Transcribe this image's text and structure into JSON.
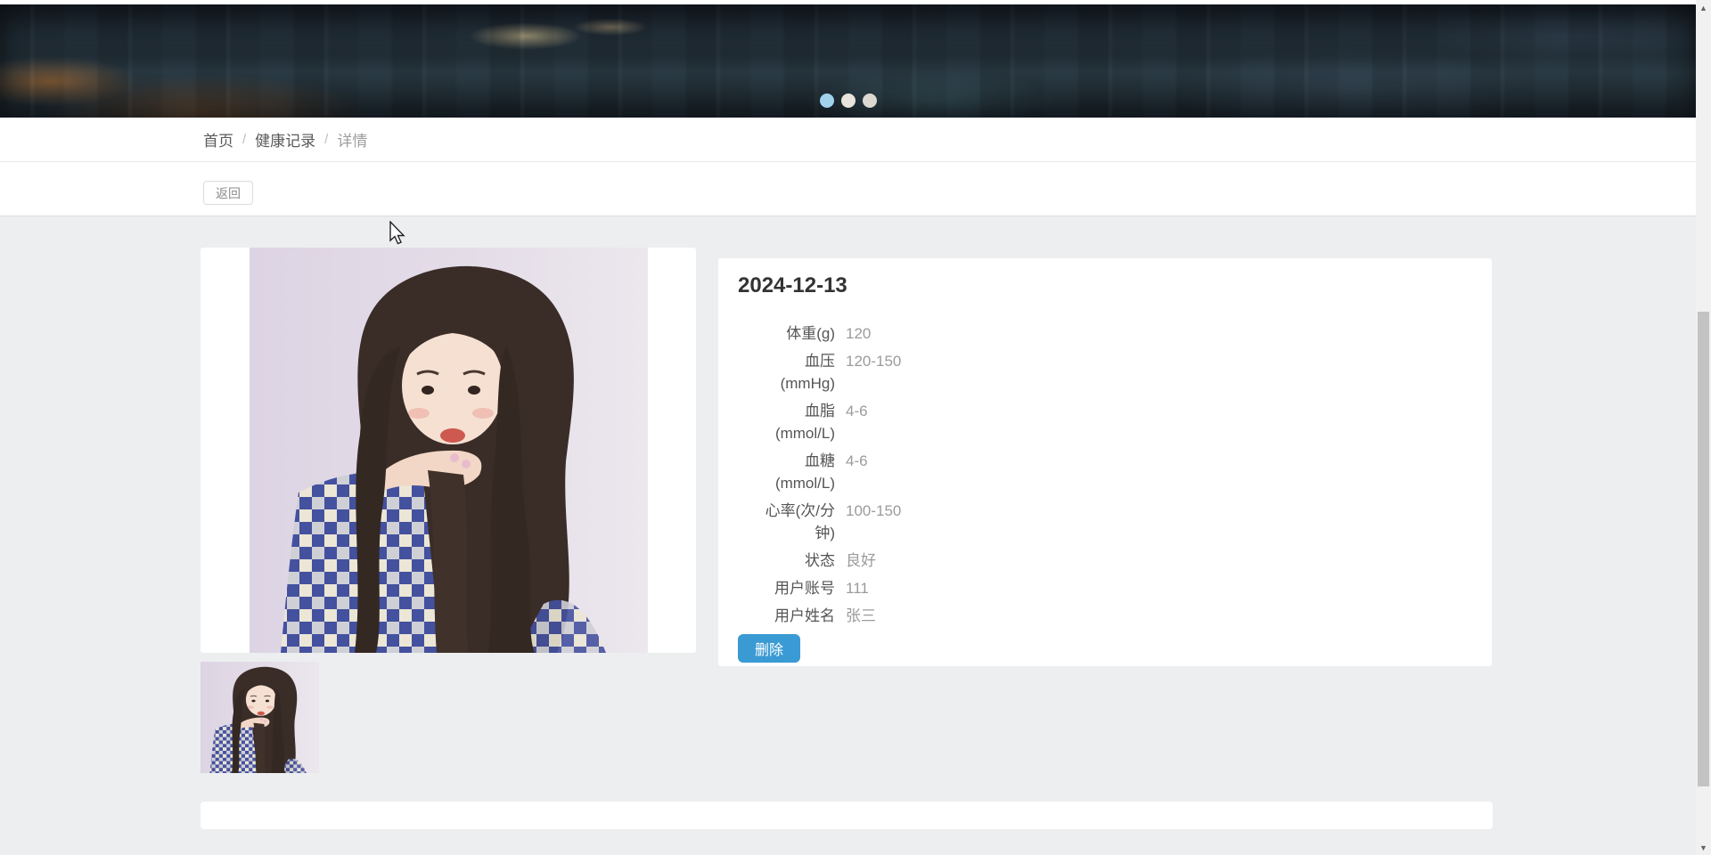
{
  "banner": {
    "description": "city-night-banner-image",
    "slide_count": 3,
    "active_slide": 0
  },
  "breadcrumb": {
    "items": [
      {
        "label": "首页"
      },
      {
        "label": "健康记录"
      },
      {
        "label": "详情"
      }
    ],
    "separator": "/"
  },
  "toolbar": {
    "back_label": "返回"
  },
  "detail": {
    "title": "2024-12-13",
    "fields": [
      {
        "label_lines": [
          "体重(g)"
        ],
        "value": "120"
      },
      {
        "label_lines": [
          "血压",
          "(mmHg)"
        ],
        "value": "120-150"
      },
      {
        "label_lines": [
          "血脂",
          "(mmol/L)"
        ],
        "value": "4-6"
      },
      {
        "label_lines": [
          "血糖",
          "(mmol/L)"
        ],
        "value": "4-6"
      },
      {
        "label_lines": [
          "心率(次/分",
          "钟)"
        ],
        "value": "100-150"
      },
      {
        "label_lines": [
          "状态"
        ],
        "value": "良好"
      },
      {
        "label_lines": [
          "用户账号"
        ],
        "value": "111"
      },
      {
        "label_lines": [
          "用户姓名"
        ],
        "value": "张三"
      }
    ],
    "delete_label": "删除"
  },
  "images": {
    "main": "portrait-photo",
    "thumbnail": "portrait-photo-thumbnail"
  },
  "colors": {
    "accent_blue": "#3a9ad3",
    "active_dot": "#9fd3ec",
    "background_gray": "#edeef0"
  }
}
